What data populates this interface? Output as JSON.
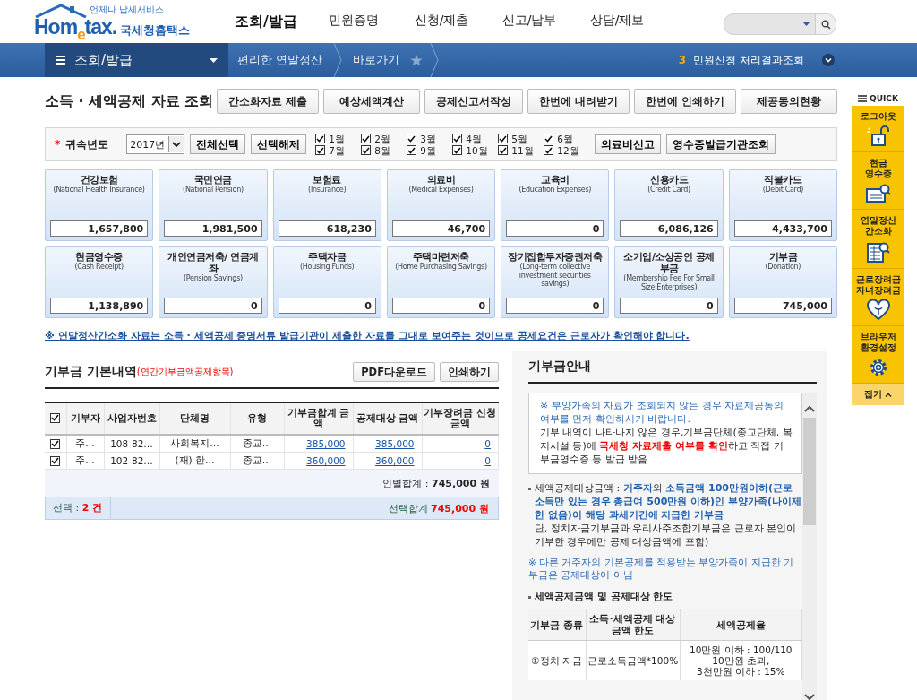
{
  "header": {
    "logo_tagline": "언제나 납세서비스",
    "logo": "Hom$_{e}$tax.",
    "logo_korean": "국세청홈택스",
    "menu": [
      {
        "label": "조회/발급",
        "selected": true
      },
      {
        "label": "민원증명",
        "selected": false
      },
      {
        "label": "신청/제출",
        "selected": false
      },
      {
        "label": "신고/납부",
        "selected": false
      },
      {
        "label": "상담/제보",
        "selected": false
      }
    ]
  },
  "nav": {
    "menu_title": "조회/발급",
    "breadcrumbs": [
      "편리한 연말정산",
      "바로가기"
    ],
    "count": "3",
    "status_link": "민원신청 처리결과조회"
  },
  "page_title": "소득 · 세액공제 자료 조회",
  "actions": [
    "간소화자료 제출",
    "예상세액계산",
    "공제신고서작성",
    "한번에 내려받기",
    "한번에 인쇄하기",
    "제공동의현황"
  ],
  "filter": {
    "required_mark": "*",
    "year_label": "귀속년도",
    "year": "2017년",
    "select_all": "전체선택",
    "deselect": "선택해제",
    "months": [
      {
        "label": "1월",
        "checked": true
      },
      {
        "label": "2월",
        "checked": true
      },
      {
        "label": "3월",
        "checked": true
      },
      {
        "label": "4월",
        "checked": true
      },
      {
        "label": "5월",
        "checked": true
      },
      {
        "label": "6월",
        "checked": true
      },
      {
        "label": "7월",
        "checked": true
      },
      {
        "label": "8월",
        "checked": true
      },
      {
        "label": "9월",
        "checked": true
      },
      {
        "label": "10월",
        "checked": true
      },
      {
        "label": "11월",
        "checked": true
      },
      {
        "label": "12월",
        "checked": true
      }
    ],
    "buttons": [
      "의료비신고",
      "영수증발급기관조회"
    ]
  },
  "categories": [
    {
      "name": "건강보험",
      "english": "(National Health Insurance)",
      "value": "1,657,800"
    },
    {
      "name": "국민연금",
      "english": "(National Pension)",
      "value": "1,981,500"
    },
    {
      "name": "보험료",
      "english": "(Insurance)",
      "value": "618,230"
    },
    {
      "name": "의료비",
      "english": "(Medical Expenses)",
      "value": "46,700"
    },
    {
      "name": "교육비",
      "english": "(Education Expenses)",
      "value": "0"
    },
    {
      "name": "신용카드",
      "english": "(Credit Card)",
      "value": "6,086,126"
    },
    {
      "name": "직불카드",
      "english": "(Debit Card)",
      "value": "4,433,700"
    },
    {
      "name": "현금영수증",
      "english": "(Cash Receipt)",
      "value": "1,138,890"
    },
    {
      "name": "개인연금저축/ 연금계좌",
      "english": "(Pension Savings)",
      "value": "0"
    },
    {
      "name": "주택자금",
      "english": "(Housing Funds)",
      "value": "0"
    },
    {
      "name": "주택마련저축",
      "english": "(Home Purchasing Savings)",
      "value": "0"
    },
    {
      "name": "장기집합투자증권저축",
      "english": "(Long-term collective investment securities savings)",
      "value": "0"
    },
    {
      "name": "소기업/소상공인 공제부금",
      "english": "(Membership Fee For Small Size Enterprises)",
      "value": "0"
    },
    {
      "name": "기부금",
      "english": "(Donation)",
      "value": "745,000"
    }
  ],
  "notice": "※ 연말정산간소화 자료는 소득 · 세액공제 증명서류 발급기관이 제출한 자료를 그대로 보여주는 것이므로 공제요건은 근로자가 확인해야 합니다.",
  "donations": {
    "title": "기부금 기본내역",
    "subtitle": "(연간기부금액공제항목)",
    "buttons": [
      "PDF다운로드",
      "인쇄하기"
    ],
    "header_checked": true,
    "columns": [
      "기부자",
      "사업자번호",
      "단체명",
      "유형",
      "기부금합계 금액",
      "공제대상 금액",
      "기부장려금 신청금액"
    ],
    "rows": [
      {
        "checked": true,
        "cells": [
          "주…",
          "108-82…",
          "사회복지…",
          "종교…"
        ],
        "amounts": [
          "385,000",
          "385,000",
          "0"
        ]
      },
      {
        "checked": true,
        "cells": [
          "주…",
          "102-82…",
          "(재) 한…",
          "종교…"
        ],
        "amounts": [
          "360,000",
          "360,000",
          "0"
        ]
      }
    ],
    "subtotal": "인별합계 : **745,000 원**",
    "selected_count": "선택 : **2 건**",
    "selected_total": "선택합계 **745,000 원**"
  },
  "guide": {
    "title": "기부금안내",
    "box_note": "※ 부양가족의 자료가 조회되지 않는 경우 자료제공동의 여부를 먼저 확인하시기 바랍니다.",
    "box_text": "기부 내역이 나타나지 않은 경우,기부금단체(종교단체, 복지시설 등)에 **국세청 자료제출 여부를 확인**하고 직접 기부금영수증 등 발급 받음",
    "bullet": "세액공제대상금액 : **거주자**와 **소득금액 100만원이하(근로소득만 있는 경우 총급여 500만원 이하)인 부양가족(나이제한 없음)이 해당 과세기간에 지급한 기부금**",
    "bullet_note": "단, 정치자금기부금과 우리사주조합기부금은 근로자 본인이 기부한 경우에만 공제 대상금액에 포함)",
    "warning": "※ 다른 거주자의 기본공제를 적용받는 부양가족이 지급한 기부금은 공제대상이 아님",
    "limits_title": "세액공제금액 및 공제대상 한도",
    "limits_columns": [
      "기부금 종류",
      "소득·세액공제 대상 금액 한도",
      "세액공제율"
    ],
    "limits_rows": [
      {
        "kind": "①정치 자금",
        "limit": "근로소득금액*100%",
        "rates": [
          "10만원 이하 : 100/110",
          "10만원 초과,",
          "3천만원 이하 : 15%"
        ]
      }
    ]
  },
  "quick": {
    "title": "QUICK",
    "items": [
      {
        "lines": [
          "로그아웃"
        ]
      },
      {
        "lines": [
          "현금",
          "영수증"
        ]
      },
      {
        "lines": [
          "연말정산",
          "간소화"
        ]
      },
      {
        "lines": [
          "근로장려금",
          "자녀장려금"
        ]
      },
      {
        "lines": [
          "브라우저",
          "환경설정"
        ]
      }
    ],
    "collapse": "접기"
  }
}
